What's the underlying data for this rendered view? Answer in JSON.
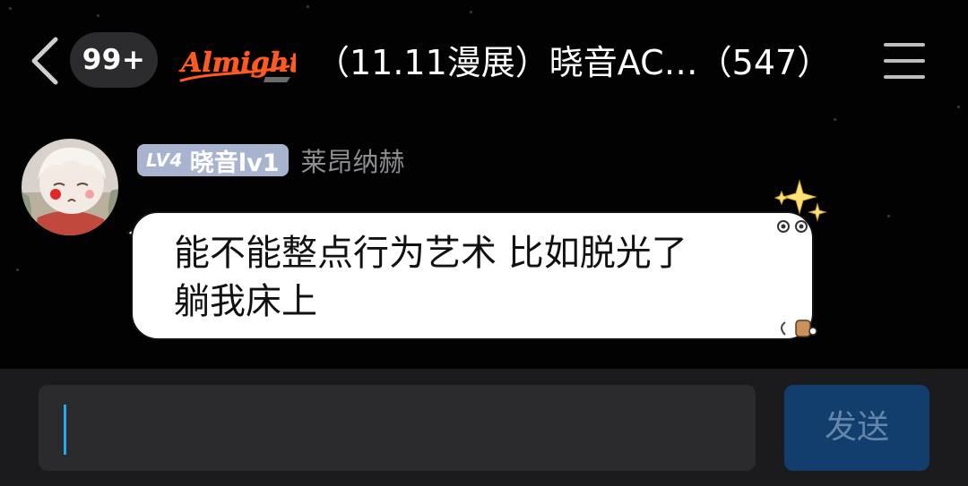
{
  "header": {
    "unread_count": "99+",
    "group_logo_text": "Almighty",
    "chat_title": "（11.11漫展）晓音AC…（547）",
    "icons": {
      "back": "chevron-left-icon",
      "menu": "hamburger-menu-icon"
    }
  },
  "message": {
    "level_tag": "LV4",
    "level_title": "晓音lv1",
    "sender_name": "莱昂纳赫",
    "text_lines": [
      "能不能整点行为艺术 比如脱光了",
      "躺我床上"
    ],
    "decorations": [
      "sparkle-icon",
      "eyes-decoration",
      "bear-decoration"
    ]
  },
  "composer": {
    "input_value": "",
    "send_label": "发送"
  },
  "colors": {
    "background": "#020202",
    "badge_bg": "#2c2c2e",
    "level_badge_bg": "#a7b3cf",
    "sender_name": "#8e8e93",
    "bubble_bg": "#ffffff",
    "input_bar_bg": "#1b1b1d",
    "input_bg": "#2b2b2d",
    "caret": "#25a8ec",
    "send_bg": "#113e6c",
    "send_text": "#6486a9",
    "logo_orange": "#ff5a1f"
  }
}
